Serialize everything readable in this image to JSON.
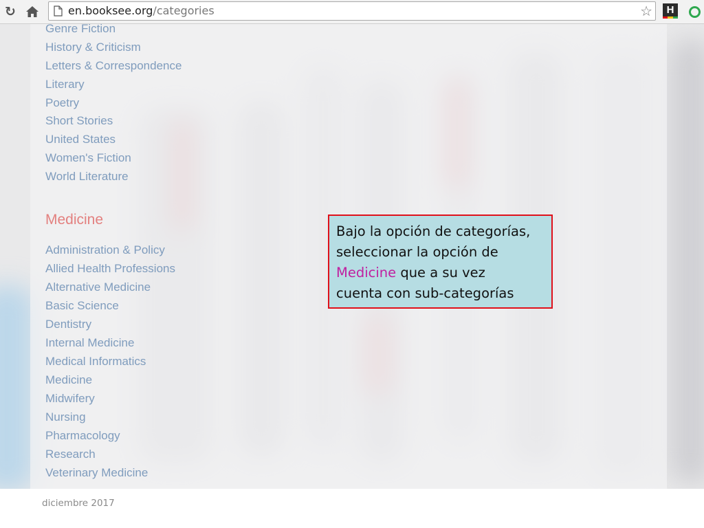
{
  "browser": {
    "url_host": "en.booksee.org",
    "url_path": "/categories",
    "extension_h_label": "H",
    "colors": {
      "toolbar_bg": "#f2f2f2",
      "extension_green": "#2fa84f"
    }
  },
  "page": {
    "fiction_items": [
      "Genre Fiction",
      "History & Criticism",
      "Letters & Correspondence",
      "Literary",
      "Poetry",
      "Short Stories",
      "United States",
      "Women's Fiction",
      "World Literature"
    ],
    "medicine_heading": "Medicine",
    "medicine_items": [
      "Administration & Policy",
      "Allied Health Professions",
      "Alternative Medicine",
      "Basic Science",
      "Dentistry",
      "Internal Medicine",
      "Medical Informatics",
      "Medicine",
      "Midwifery",
      "Nursing",
      "Pharmacology",
      "Research",
      "Veterinary Medicine"
    ],
    "colors": {
      "link": "#7f9cbd",
      "heading": "#e3807f"
    }
  },
  "callout": {
    "line1": "Bajo la opción de categorías,",
    "line2": "seleccionar la opción de",
    "highlight": "Medicine",
    "line3_rest": " que a su vez",
    "line4": "cuenta con sub-categorías",
    "colors": {
      "background": "#b6dde3",
      "border": "#e0101a",
      "highlight": "#c020a0"
    }
  },
  "footer": {
    "date": "diciembre 2017"
  }
}
